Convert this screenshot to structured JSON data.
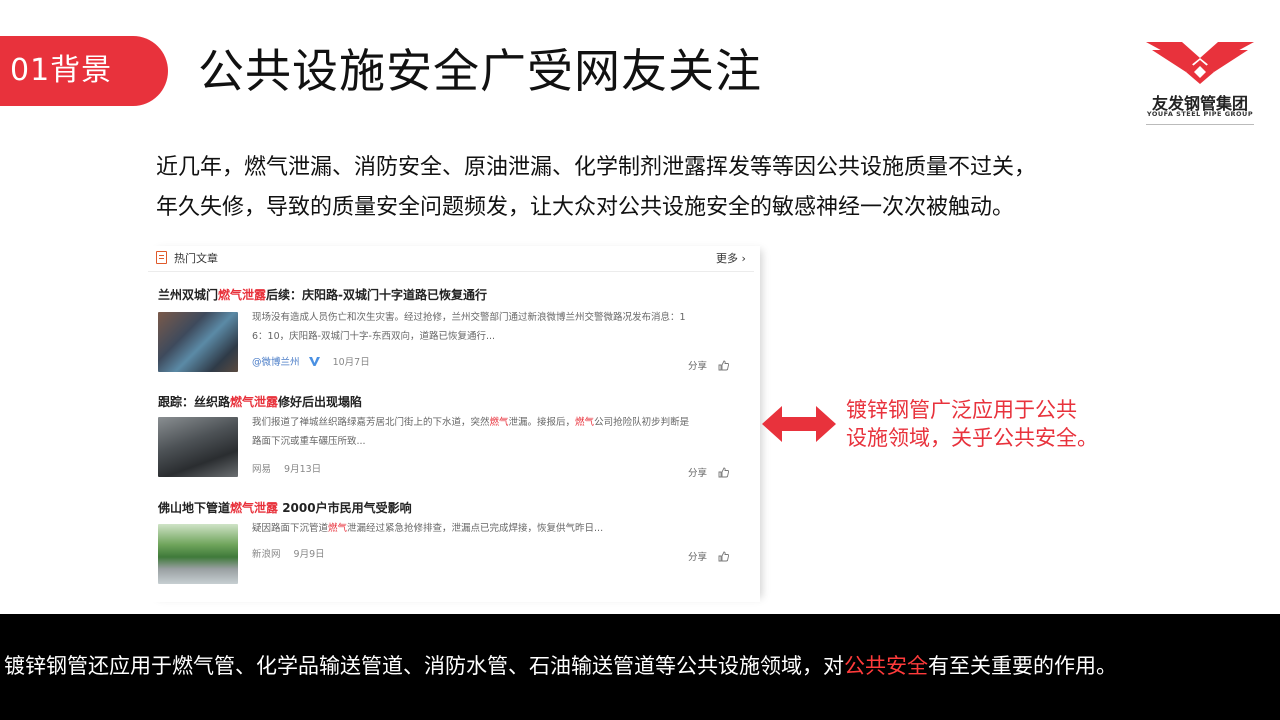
{
  "header": {
    "section_tag": "01背景",
    "title": "公共设施安全广受网友关注"
  },
  "logo": {
    "name": "友发钢管集团",
    "subtitle": "YOUFA STEEL PIPE GROUP"
  },
  "intro": {
    "line1": "近几年，燃气泄漏、消防安全、原油泄漏、化学制剂泄露挥发等等因公共设施质量不过关，",
    "line2": "年久失修，导致的质量安全问题频发，让大众对公共设施安全的敏感神经一次次被触动。"
  },
  "news": {
    "header_label": "热门文章",
    "more_label": "更多",
    "more_arrow": "›",
    "articles": [
      {
        "title_pre": "兰州双城门",
        "title_hl": "燃气泄露",
        "title_post": "后续：庆阳路-双城门十字道路已恢复通行",
        "desc_line1": "现场没有造成人员伤亡和次生灾害。经过抢修，兰州交警部门通过新浪微博兰州交警微路况发布消息：1",
        "desc_line2": "6：10，庆阳路-双城门十字-东西双向，道路已恢复通行...",
        "source": "@微博兰州",
        "date": "10月7日",
        "share_label": "分享"
      },
      {
        "title_pre": "跟踪：丝织路",
        "title_hl": "燃气泄露",
        "title_post": "修好后出现塌陷",
        "desc_pre": "我们报道了禅城丝织路绿嘉芳居北门街上的下水道，突然",
        "desc_hl1": "燃气",
        "desc_mid": "泄漏。接报后，",
        "desc_hl2": "燃气",
        "desc_post": "公司抢险队初步判断是",
        "desc_line2": "路面下沉或重车碾压所致...",
        "source": "网易",
        "date": "9月13日",
        "share_label": "分享"
      },
      {
        "title_pre": "佛山地下管道",
        "title_hl": "燃气泄露",
        "title_post": " 2000户市民用气受影响",
        "desc_pre": "疑因路面下沉管道",
        "desc_hl": "燃气",
        "desc_post": "泄漏经过紧急抢修排查，泄漏点已完成焊接，恢复供气昨日...",
        "source": "新浪网",
        "date": "9月9日",
        "share_label": "分享"
      }
    ]
  },
  "callout": {
    "line1": "镀锌钢管广泛应用于公共",
    "line2": "设施领域，关乎公共安全。"
  },
  "footer": {
    "text_pre": "镀锌钢管还应用于燃气管、化学品输送管道、消防水管、石油输送管道等公共设施领域，对",
    "text_hl": "公共安全",
    "text_post": "有至关重要的作用。"
  },
  "colors": {
    "accent_red": "#e8323c",
    "footer_bg": "#000000",
    "link_blue": "#4a7cc7"
  }
}
